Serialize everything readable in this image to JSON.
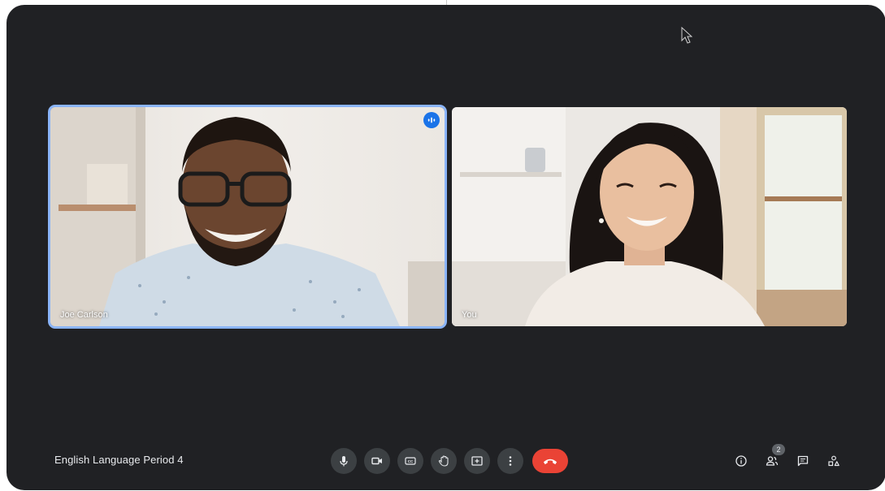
{
  "meeting": {
    "title": "English Language Period 4"
  },
  "participants": [
    {
      "name": "Joe Carlson",
      "is_speaking": true
    },
    {
      "name": "You",
      "is_speaking": false
    }
  ],
  "controls": [
    {
      "icon": "mic-icon",
      "state": "on"
    },
    {
      "icon": "camera-icon",
      "state": "on"
    },
    {
      "icon": "captions-icon"
    },
    {
      "icon": "raise-hand-icon"
    },
    {
      "icon": "present-screen-icon"
    },
    {
      "icon": "more-options-icon"
    },
    {
      "icon": "end-call-icon"
    }
  ],
  "right_tools": {
    "info_icon": "info-icon",
    "people_icon": "people-icon",
    "people_count": "2",
    "chat_icon": "chat-icon",
    "activities_icon": "activities-icon"
  },
  "colors": {
    "background": "#202124",
    "control_button": "#3c4043",
    "end_call": "#ea4335",
    "active_speaker_border": "#8ab4f8",
    "speaking_badge": "#1a73e8"
  }
}
